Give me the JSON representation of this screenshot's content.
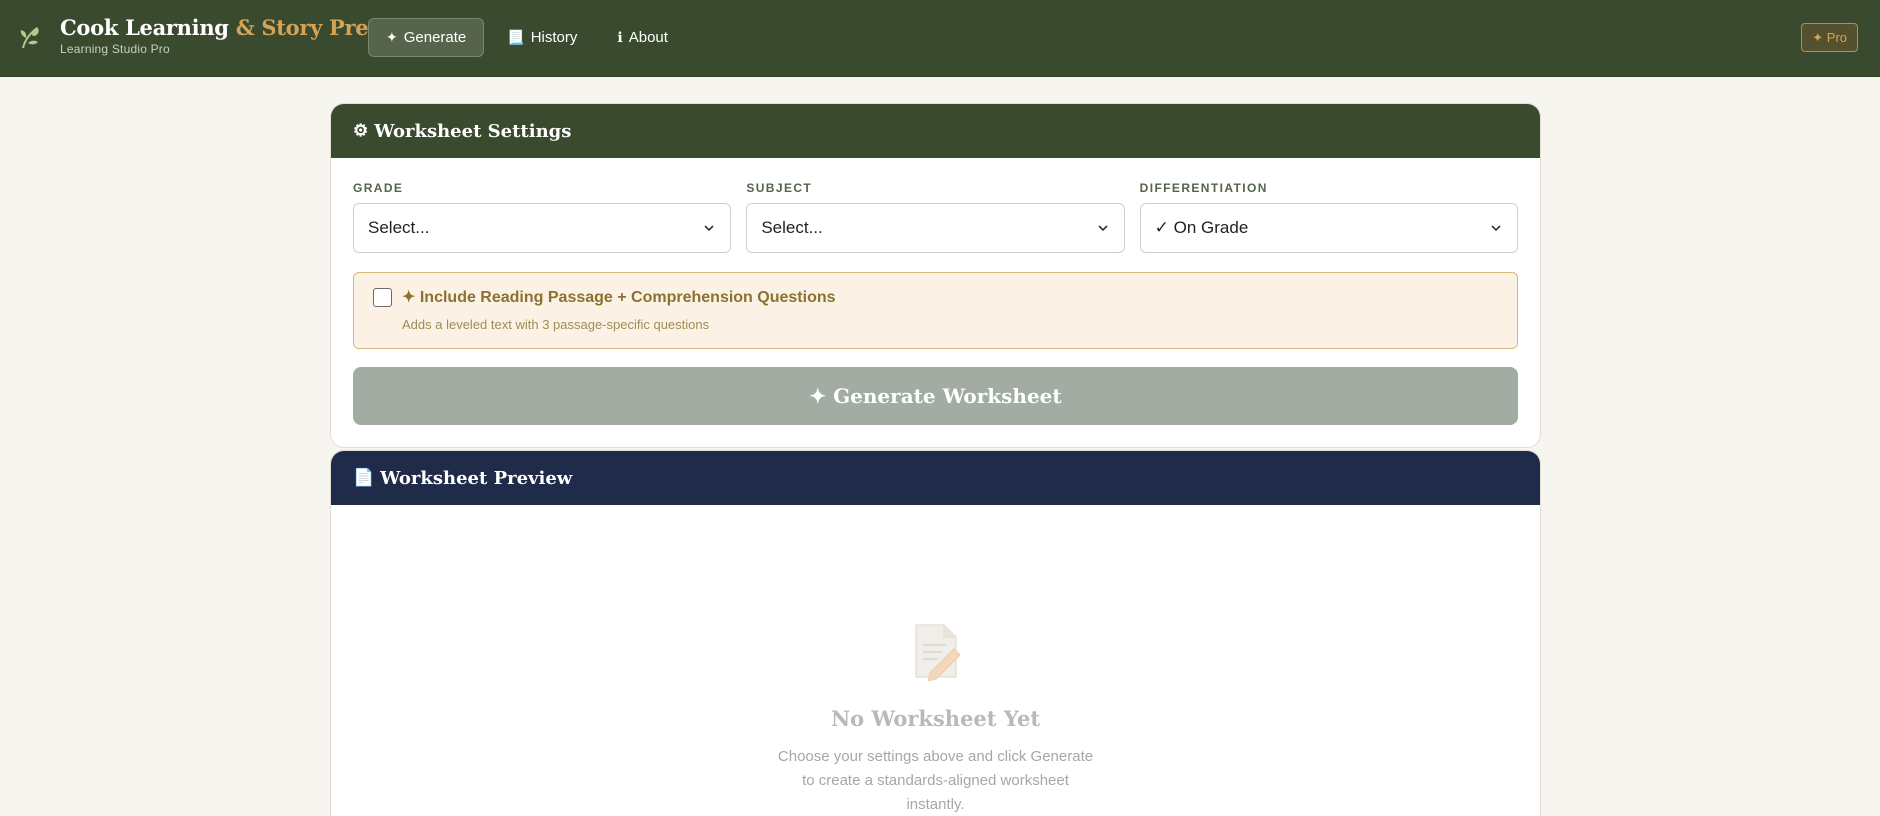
{
  "header": {
    "brand_main": "Cook Learning",
    "brand_accent": "& Story Press",
    "brand_sub": "Learning Studio Pro",
    "nav": [
      {
        "glyph": "✦",
        "label": "Generate",
        "active": true
      },
      {
        "glyph": "📃",
        "label": "History"
      },
      {
        "glyph": "ℹ",
        "label": "About"
      }
    ],
    "pro_badge": "✦ Pro"
  },
  "settings": {
    "title": "Worksheet Settings",
    "icon": "⚙",
    "fields": [
      {
        "label": "GRADE",
        "value": "Select..."
      },
      {
        "label": "SUBJECT",
        "value": "Select..."
      },
      {
        "label": "DIFFERENTIATION",
        "value": "✓ On Grade"
      }
    ],
    "passage": {
      "title": "✦ Include Reading Passage + Comprehension Questions",
      "subtitle": "Adds a leveled text with 3 passage-specific questions",
      "checked": false
    },
    "generate_label": "✦ Generate Worksheet"
  },
  "preview": {
    "icon": "📄",
    "title": "Worksheet Preview",
    "empty_title": "No Worksheet Yet",
    "empty_text": "Choose your settings above and click Generate to create a standards-aligned worksheet instantly."
  },
  "colors": {
    "header_green": "#3a4a2f",
    "accent_gold": "#d4a456",
    "preview_navy": "#1f2b49",
    "button_disabled": "#a3aca2"
  }
}
